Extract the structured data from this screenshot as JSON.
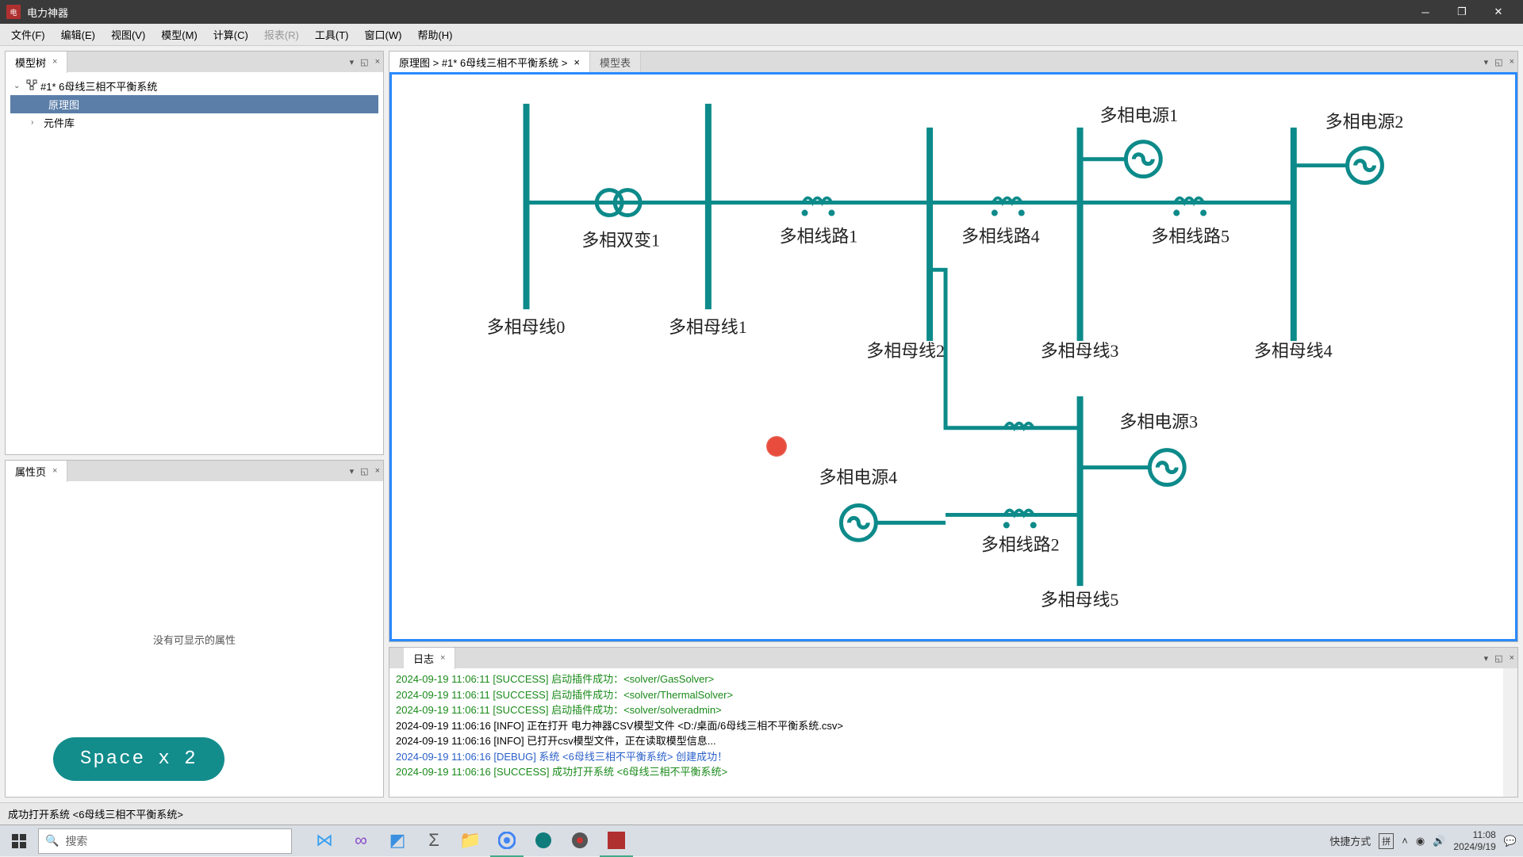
{
  "app": {
    "title": "电力神器"
  },
  "menu": {
    "items": [
      "文件(F)",
      "编辑(E)",
      "视图(V)",
      "模型(M)",
      "计算(C)",
      "报表(R)",
      "工具(T)",
      "窗口(W)",
      "帮助(H)"
    ],
    "disabled_index": 5
  },
  "tree_panel": {
    "tab": "模型树",
    "root": "#1* 6母线三相不平衡系统",
    "children": [
      "原理图",
      "元件库"
    ],
    "selected_index": 0
  },
  "prop_panel": {
    "tab": "属性页",
    "empty_text": "没有可显示的属性"
  },
  "overlay": {
    "text": "Space x 2"
  },
  "diagram_panel": {
    "tab_active": "原理图 > #1* 6母线三相不平衡系统 >",
    "tab_inactive": "模型表",
    "labels": {
      "bus0": "多相母线0",
      "bus1": "多相母线1",
      "bus2": "多相母线2",
      "bus3": "多相母线3",
      "bus4": "多相母线4",
      "bus5": "多相母线5",
      "xfmr": "多相双变1",
      "line1": "多相线路1",
      "line2": "多相线路2",
      "line4": "多相线路4",
      "line5": "多相线路5",
      "src1": "多相电源1",
      "src2": "多相电源2",
      "src3": "多相电源3",
      "src4": "多相电源4"
    }
  },
  "log_panel": {
    "tab": "日志",
    "lines": [
      {
        "cls": "success",
        "text": "2024-09-19 11:06:11 [SUCCESS] 启动插件成功：<solver/GasSolver>"
      },
      {
        "cls": "success",
        "text": "2024-09-19 11:06:11 [SUCCESS] 启动插件成功：<solver/ThermalSolver>"
      },
      {
        "cls": "success",
        "text": "2024-09-19 11:06:11 [SUCCESS] 启动插件成功：<solver/solveradmin>"
      },
      {
        "cls": "info",
        "text": "2024-09-19 11:06:16 [INFO] 正在打开 电力神器CSV模型文件 <D:/桌面/6母线三相不平衡系统.csv>"
      },
      {
        "cls": "info",
        "text": "2024-09-19 11:06:16 [INFO] 已打开csv模型文件，正在读取模型信息..."
      },
      {
        "cls": "debug",
        "text": "2024-09-19 11:06:16 [DEBUG] 系统 <6母线三相不平衡系统> 创建成功！"
      },
      {
        "cls": "success",
        "text": "2024-09-19 11:06:16 [SUCCESS] 成功打开系统 <6母线三相不平衡系统>"
      }
    ]
  },
  "status": {
    "text": "成功打开系统 <6母线三相不平衡系统>"
  },
  "taskbar": {
    "search_placeholder": "搜索",
    "tray_label": "快捷方式",
    "ime": "拼",
    "time": "11:08",
    "date": "2024/9/19"
  }
}
